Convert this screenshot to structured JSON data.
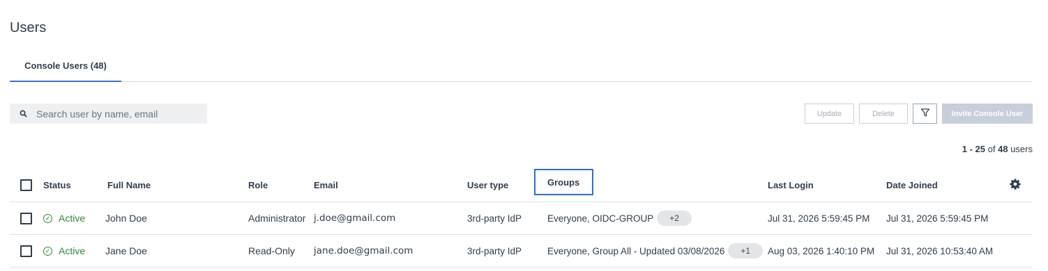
{
  "page": {
    "title": "Users"
  },
  "tabs": [
    {
      "label": "Console Users (48)"
    }
  ],
  "search": {
    "placeholder": "Search user by name, email"
  },
  "toolbar": {
    "update_label": "Update",
    "delete_label": "Delete",
    "filter_icon": "filter-icon",
    "invite_label": "Invite Console User"
  },
  "pagination": {
    "range": "1 - 25",
    "of": "of",
    "total": "48",
    "unit": "users"
  },
  "table": {
    "columns": {
      "status": "Status",
      "full_name": "Full Name",
      "role": "Role",
      "email": "Email",
      "user_type": "User type",
      "groups": "Groups",
      "last_login": "Last Login",
      "date_joined": "Date Joined"
    },
    "rows": [
      {
        "status": "Active",
        "full_name": "John Doe",
        "role": "Administrator",
        "email": "j.doe@gmail.com",
        "user_type": "3rd-party IdP",
        "groups": "Everyone, OIDC-GROUP",
        "groups_more": "+2",
        "last_login": "Jul 31, 2026 5:59:45 PM",
        "date_joined": "Jul 31, 2026 5:59:45 PM"
      },
      {
        "status": "Active",
        "full_name": "Jane Doe",
        "role": "Read-Only",
        "email": "jane.doe@gmail.com",
        "user_type": "3rd-party IdP",
        "groups": "Everyone, Group All - Updated 03/08/2026",
        "groups_more": "+1",
        "last_login": "Aug 03, 2026 1:40:10 PM",
        "date_joined": "Jul 31, 2026 10:53:40 AM"
      }
    ]
  },
  "colors": {
    "accent": "#3b6fd4",
    "active": "#2e8a3a",
    "text": "#2f3e4e"
  }
}
